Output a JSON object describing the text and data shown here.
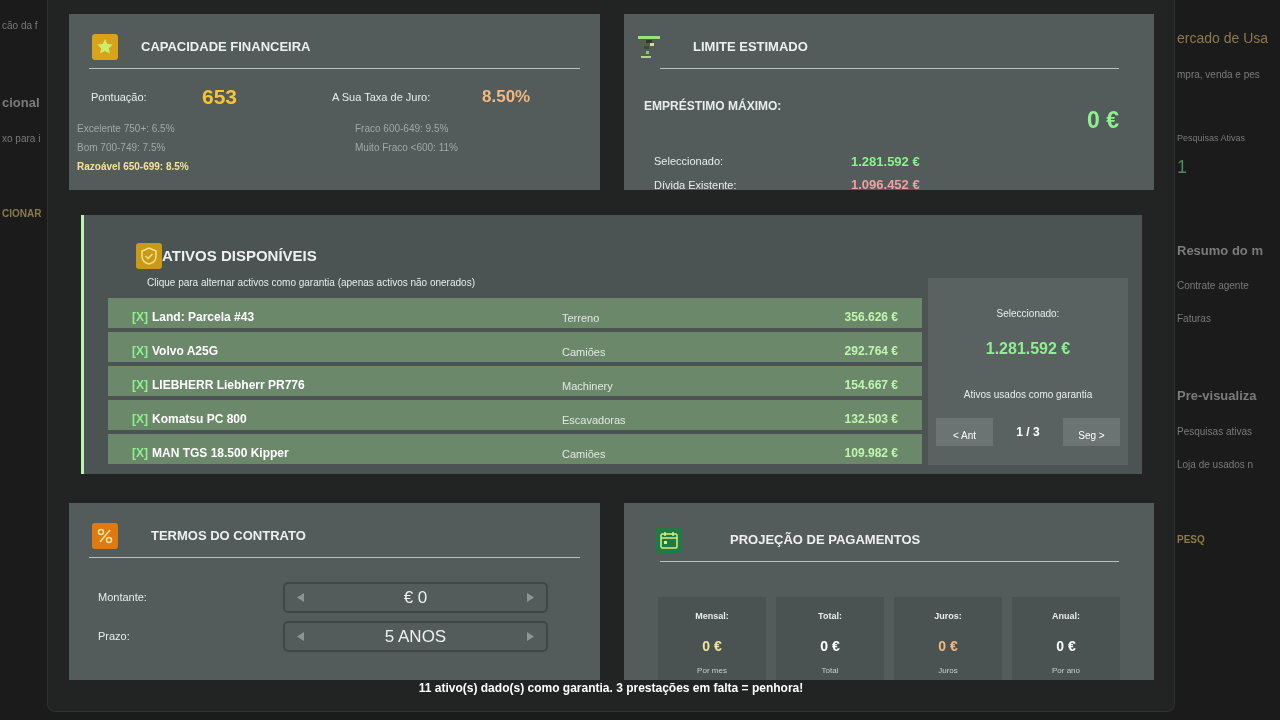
{
  "background": {
    "left_texts": [
      {
        "text": "cão da f",
        "kind": "sub"
      },
      {
        "text": "cional",
        "kind": "heading"
      },
      {
        "text": "xo para i",
        "kind": "sub"
      },
      {
        "text": "CIONAR",
        "kind": "button"
      }
    ],
    "right_texts": [
      {
        "text": "ercado de Usa",
        "kind": "title"
      },
      {
        "text": "mpra, venda e pes",
        "kind": "sub"
      },
      {
        "text": "Pesquisas Ativas",
        "kind": "small"
      },
      {
        "text": "1",
        "kind": "stat"
      },
      {
        "text": "Resumo do m",
        "kind": "heading"
      },
      {
        "text": "Contrate agente",
        "kind": "sub"
      },
      {
        "text": "Faturas",
        "kind": "sub"
      },
      {
        "text": "Pre-visualiza",
        "kind": "heading"
      },
      {
        "text": "Pesquisas ativas",
        "kind": "sub"
      },
      {
        "text": "Loja de usados n",
        "kind": "sub"
      },
      {
        "text": "PESQ",
        "kind": "button"
      }
    ]
  },
  "financial_capacity": {
    "title": "CAPACIDADE FINANCEIRA",
    "score_label": "Pontuação:",
    "score": "653",
    "rate_label": "A Sua Taxa de Juro:",
    "rate": "8.50%",
    "tiers": [
      {
        "label": "Excelente 750+: 6.5%",
        "selected": false
      },
      {
        "label": "Fraco 600-649: 9.5%",
        "selected": false
      },
      {
        "label": "Bom 700-749: 7.5%",
        "selected": false
      },
      {
        "label": "Muito Fraco <600: 11%",
        "selected": false
      },
      {
        "label": "Razoável 650-699: 8.5%",
        "selected": true
      }
    ]
  },
  "limit": {
    "title": "LIMITE ESTIMADO",
    "max_label": "EMPRÉSTIMO MÁXIMO:",
    "max_value": "0 €",
    "rows": [
      {
        "label": "Seleccionado:",
        "value": "1.281.592 €",
        "kind": "positive"
      },
      {
        "label": "Dívida Existente:",
        "value": "1.096.452 €",
        "kind": "negative"
      }
    ]
  },
  "assets": {
    "title": "ATIVOS DISPONÍVEIS",
    "hint": "Clique para alternar activos como garantia (apenas activos não onerados)",
    "items": [
      {
        "marker": "[X]",
        "name": "Land: Parcela #43",
        "category": "Terreno",
        "value": "356.626 €",
        "selected": true
      },
      {
        "marker": "[X]",
        "name": "Volvo A25G",
        "category": "Camiões",
        "value": "292.764 €",
        "selected": true
      },
      {
        "marker": "[X]",
        "name": "LIEBHERR Liebherr PR776",
        "category": "Machinery",
        "value": "154.667 €",
        "selected": true
      },
      {
        "marker": "[X]",
        "name": "Komatsu PC 800",
        "category": "Escavadoras",
        "value": "132.503 €",
        "selected": true
      },
      {
        "marker": "[X]",
        "name": "MAN TGS 18.500 Kipper",
        "category": "Camiões",
        "value": "109.982 €",
        "selected": true
      }
    ],
    "summary": {
      "label": "Seleccionado:",
      "total": "1.281.592 €",
      "caption": "Ativos usados como garantia",
      "prev": "< Ant",
      "page": "1 / 3",
      "next": "Seg >"
    }
  },
  "terms": {
    "title": "TERMOS DO CONTRATO",
    "fields": [
      {
        "label": "Montante:",
        "value": "€ 0"
      },
      {
        "label": "Prazo:",
        "value": "5 ANOS"
      }
    ]
  },
  "projection": {
    "title": "PROJEÇÃO DE PAGAMENTOS",
    "tiles": [
      {
        "label": "Mensal:",
        "value": "0 €",
        "caption": "Por mes",
        "color": "#f3e39a"
      },
      {
        "label": "Total:",
        "value": "0 €",
        "caption": "Total",
        "color": "#ffffff"
      },
      {
        "label": "Juros:",
        "value": "0 €",
        "caption": "Juros",
        "color": "#f2b880"
      },
      {
        "label": "Anual:",
        "value": "0 €",
        "caption": "Por ano",
        "color": "#ffffff"
      }
    ]
  },
  "footer": "11 ativo(s) dado(s) como garantia. 3 prestações em falta = penhora!"
}
